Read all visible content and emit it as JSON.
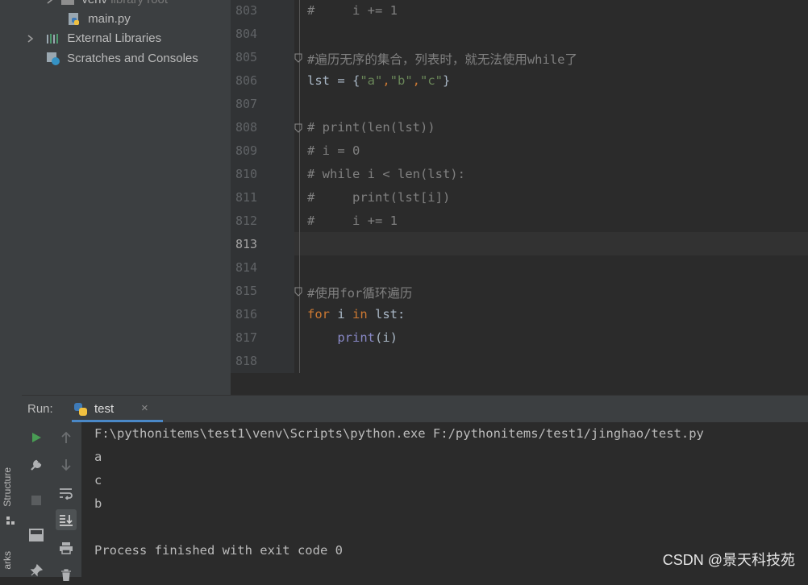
{
  "side_tabs": {
    "structure": "Structure",
    "bookmarks": "arks"
  },
  "project_tree": {
    "venv": {
      "name": "venv",
      "note": "library root"
    },
    "main_py": "main.py",
    "external_libraries": "External Libraries",
    "scratches": "Scratches and Consoles"
  },
  "editor": {
    "line_numbers": [
      "803",
      "804",
      "805",
      "806",
      "807",
      "808",
      "809",
      "810",
      "811",
      "812",
      "813",
      "814",
      "815",
      "816",
      "817",
      "818"
    ],
    "current_line": "813",
    "lines": {
      "l803": "#     i += 1",
      "l805": "#遍历无序的集合，列表时，就无法使用while了",
      "l806a": "lst = {",
      "l806b": "\"a\"",
      "l806c": ",",
      "l806d": "\"b\"",
      "l806e": ",",
      "l806f": "\"c\"",
      "l806g": "}",
      "l808": "# print(len(lst))",
      "l809": "# i = 0",
      "l810": "# while i < len(lst):",
      "l811": "#     print(lst[i])",
      "l812": "#     i += 1",
      "l815": "#使用for循环遍历",
      "l816_for": "for",
      "l816_i": " i ",
      "l816_in": "in",
      "l816_rest": " lst:",
      "l817_indent": "    ",
      "l817_print": "print",
      "l817_rest": "(i)"
    }
  },
  "run_panel": {
    "label": "Run:",
    "tab": "test",
    "tab_close": "×",
    "output": [
      "F:\\pythonitems\\test1\\venv\\Scripts\\python.exe F:/pythonitems/test1/jinghao/test.py",
      "a",
      "c",
      "b",
      "",
      "Process finished with exit code 0"
    ]
  },
  "watermark": "CSDN @景天科技苑",
  "colors": {
    "accent": "#4a88c7",
    "run_green": "#499c54",
    "keyword": "#cc7832",
    "string": "#6a8759",
    "builtin": "#8888c6"
  }
}
